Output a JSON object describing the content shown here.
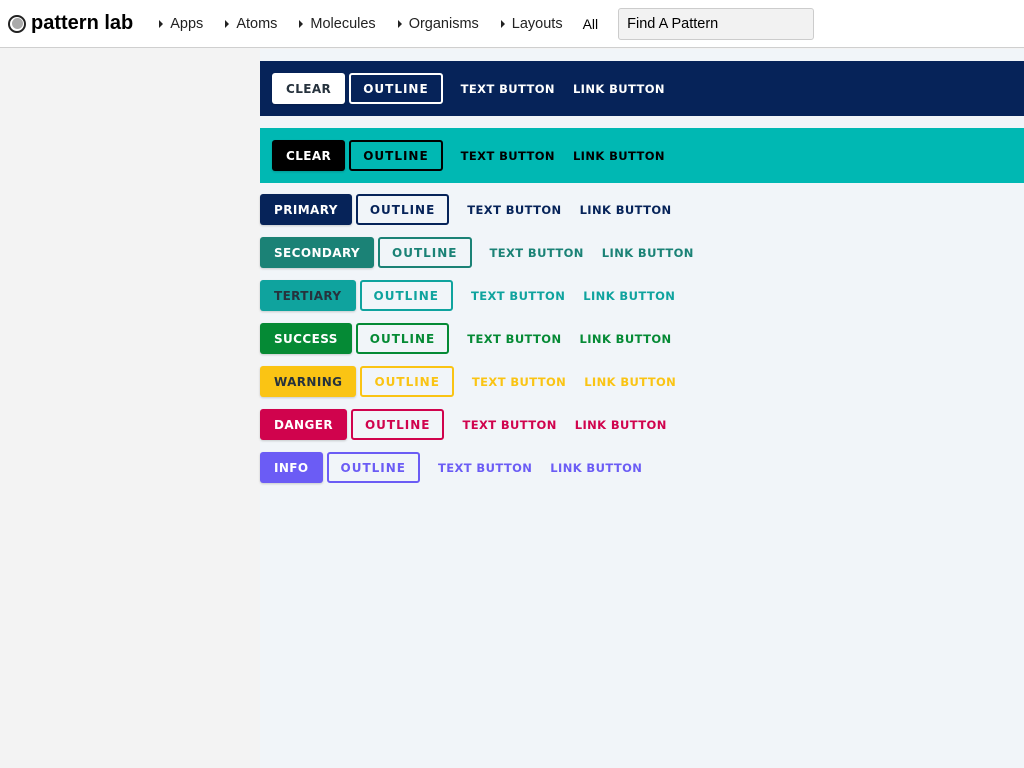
{
  "header": {
    "logo_text": "pattern lab",
    "nav": [
      {
        "label": "Apps"
      },
      {
        "label": "Atoms"
      },
      {
        "label": "Molecules"
      },
      {
        "label": "Organisms"
      },
      {
        "label": "Layouts"
      }
    ],
    "all_label": "All",
    "search_placeholder": "Find A Pattern"
  },
  "bands": [
    {
      "name": "navy",
      "background": "#062359",
      "clear_label": "CLEAR",
      "outline_label": "OUTLINE",
      "text_label": "TEXT BUTTON",
      "link_label": "LINK BUTTON"
    },
    {
      "name": "teal",
      "background": "#00b8b3",
      "clear_label": "CLEAR",
      "outline_label": "OUTLINE",
      "text_label": "TEXT BUTTON",
      "link_label": "LINK BUTTON"
    }
  ],
  "rows": [
    {
      "label": "PRIMARY",
      "color": "#062359",
      "solid_text": "#ffffff",
      "outline_label": "OUTLINE",
      "text_label": "TEXT BUTTON",
      "link_label": "LINK BUTTON"
    },
    {
      "label": "SECONDARY",
      "color": "#1b8276",
      "solid_text": "#ffffff",
      "outline_label": "OUTLINE",
      "text_label": "TEXT BUTTON",
      "link_label": "LINK BUTTON"
    },
    {
      "label": "TERTIARY",
      "color": "#0fa39e",
      "solid_text": "#26323d",
      "outline_label": "OUTLINE",
      "text_label": "TEXT BUTTON",
      "link_label": "LINK BUTTON"
    },
    {
      "label": "SUCCESS",
      "color": "#058a35",
      "solid_text": "#ffffff",
      "outline_label": "OUTLINE",
      "text_label": "TEXT BUTTON",
      "link_label": "LINK BUTTON"
    },
    {
      "label": "WARNING",
      "color": "#fac414",
      "solid_text": "#26323d",
      "outline_label": "OUTLINE",
      "text_label": "TEXT BUTTON",
      "link_label": "LINK BUTTON"
    },
    {
      "label": "DANGER",
      "color": "#d0034d",
      "solid_text": "#ffffff",
      "outline_label": "OUTLINE",
      "text_label": "TEXT BUTTON",
      "link_label": "LINK BUTTON"
    },
    {
      "label": "INFO",
      "color": "#6b5cf5",
      "solid_text": "#ffffff",
      "outline_label": "OUTLINE",
      "text_label": "TEXT BUTTON",
      "link_label": "LINK BUTTON"
    }
  ]
}
